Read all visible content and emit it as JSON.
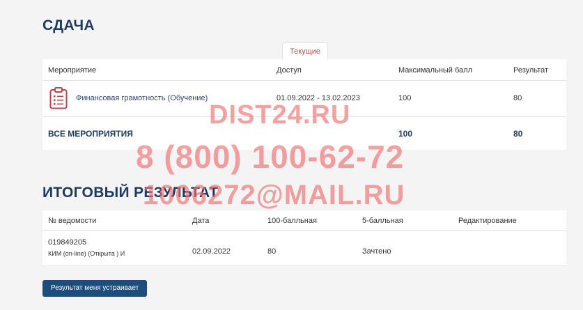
{
  "submission": {
    "title": "СДАЧА",
    "tab_label": "Текущие",
    "headers": {
      "event": "Мероприятие",
      "access": "Доступ",
      "max_score": "Максимальный балл",
      "result": "Результат"
    },
    "rows": [
      {
        "icon": "clipboard-icon",
        "event": "Финансовая грамотность (Обучение)",
        "access": "01.09.2022 - 13.02.2023",
        "max_score": "100",
        "result": "80"
      }
    ],
    "total": {
      "label": "ВСЕ МЕРОПРИЯТИЯ",
      "max_score": "100",
      "result": "80"
    }
  },
  "final": {
    "title": "ИТОГОВЫЙ РЕЗУЛЬТАТ",
    "headers": {
      "statement_no": "№ ведомости",
      "date": "Дата",
      "score100": "100-балльная",
      "score5": "5-балльная",
      "editing": "Редактирование"
    },
    "rows": [
      {
        "statement_no": "019849205",
        "statement_sub": "КИМ (on-line) (Открыта ) И",
        "date": "02.09.2022",
        "score100": "80",
        "score5": "Зачтено",
        "editing": ""
      }
    ],
    "accept_button": "Результат меня устраивает"
  },
  "watermark": {
    "line1": "DIST24.RU",
    "line2": "8  (800)  100-62-72",
    "line3": "1006272@MAIL.RU"
  },
  "colors": {
    "heading": "#1e3a5f",
    "tab_text": "#c0504d",
    "button_bg": "#1e4d7d",
    "icon": "#c0454f"
  }
}
